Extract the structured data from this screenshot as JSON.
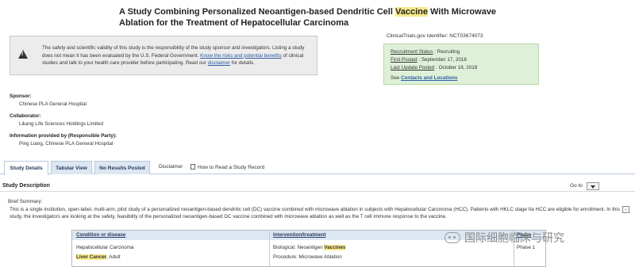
{
  "study": {
    "title_part1": "A Study Combining Personalized Neoantigen-based Dendritic Cell ",
    "title_highlight": "Vaccine",
    "title_part2": " With Microwave Ablation for the Treatment of Hepatocellular Carcinoma"
  },
  "disclaimer": {
    "text1": "The safety and scientific validity of this study is the responsibility of the study sponsor and investigators. Listing a study does not mean it has been evaluated by the U.S. Federal Government. ",
    "link1": "Know the risks and potential benefits",
    "text2": " of clinical studies and talk to your health care provider before participating. Read our ",
    "link2": "disclaimer",
    "text3": " for details."
  },
  "status": {
    "identifier_label": "ClinicalTrials.gov Identifier:",
    "identifier_value": "NCT03674073",
    "recruitment_label": "Recruitment Status",
    "recruitment_value": "Recruiting",
    "first_posted_label": "First Posted",
    "first_posted_value": "September 17, 2018",
    "last_update_label": "Last Update Posted",
    "last_update_value": "October 18, 2018",
    "see_text": "See",
    "contacts_link": "Contacts and Locations"
  },
  "info": {
    "sponsor_label": "Sponsor:",
    "sponsor_value": "Chinese PLA General Hospital",
    "collaborator_label": "Collaborator:",
    "collaborator_value": "Likang Life Sciences Holdings Limited",
    "provided_label": "Information provided by (Responsible Party):",
    "provided_value": "Ping Liang, Chinese PLA General Hospital"
  },
  "tabs": {
    "study_details": "Study Details",
    "tabular_view": "Tabular View",
    "no_results": "No Results Posted",
    "disclaimer": "Disclaimer",
    "how_to_read": "How to Read a Study Record"
  },
  "description": {
    "section_title": "Study Description",
    "goto_label": "Go to",
    "collapse_symbol": "-",
    "summary_label": "Brief Summary:",
    "summary_text": "This is a single institution, open-label, multi-arm, pilot study of a personalized neoantigen-based dendritic cell (DC) vaccine combined with microwave ablation in subjects with Hepatocellular Carcinoma (HCC). Patients with HKLC stage IIa HCC are eligible for enrollment. In this study, the investigators are looking at the safety, feasibility of the personalized neoantigen-based DC vaccine combined with microwave ablation as well as the T cell immune response to the vaccine."
  },
  "conditions_table": {
    "headers": [
      "Condition or disease",
      "Intervention/treatment",
      "Phase"
    ],
    "condition_1": "Hepatocellular Carcinoma",
    "condition_2_highlight": "Liver Cancer",
    "condition_2_rest": ", Adult",
    "intervention_1_prefix": "Biological: Neoantigen ",
    "intervention_1_highlight": "Vaccines",
    "intervention_2": "Procedure: Microwave Ablation",
    "phase_value": "Phase 1"
  },
  "watermark": {
    "text": "国际细胞临床与研究"
  }
}
